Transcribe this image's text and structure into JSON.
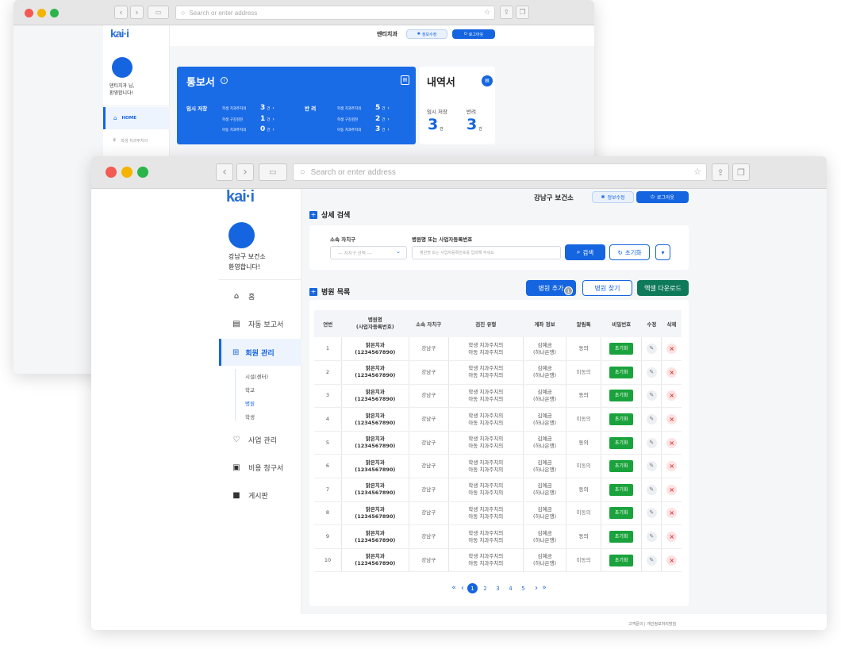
{
  "back_window": {
    "address_placeholder": "Search or enter address",
    "header": {
      "org_name": "덴티치과",
      "edit_info": "정보수정",
      "logout": "로그아웃"
    },
    "logo": "kai·i",
    "logo_sub": "",
    "user": {
      "name_line": "덴티치과 님,",
      "welcome": "환영합니다!"
    },
    "menu": {
      "home": "HOME",
      "school": "학생 치과주치의"
    },
    "report_card": {
      "title": "통보서",
      "temp_save_label": "임시 저장",
      "return_label": "반 려",
      "temp_rows": [
        {
          "label": "학생 치과주치의",
          "count": "3",
          "unit": "건"
        },
        {
          "label": "학생 구강검진",
          "count": "1",
          "unit": "건"
        },
        {
          "label": "아동 치과주치의",
          "count": "0",
          "unit": "건"
        }
      ],
      "return_rows": [
        {
          "label": "학생 치과주치의",
          "count": "5",
          "unit": "건"
        },
        {
          "label": "학생 구강검진",
          "count": "2",
          "unit": "건"
        },
        {
          "label": "아동 치과주치의",
          "count": "3",
          "unit": "건"
        }
      ]
    },
    "history_card": {
      "title": "내역서",
      "temp_label": "임시 저장",
      "return_label": "반려",
      "temp_count": "3",
      "return_count": "3",
      "unit": "건"
    }
  },
  "front_window": {
    "address_placeholder": "Search or enter address",
    "logo": "kai·i",
    "header": {
      "org_name": "강남구 보건소",
      "edit_info": "정보수정",
      "logout": "로그아웃"
    },
    "user": {
      "name": "강남구 보건소",
      "welcome": "환영합니다!"
    },
    "menu": {
      "home": "홈",
      "auto_report": "자동 보고서",
      "member_mgmt": "회원 관리",
      "sub_items": [
        "시설(센터)",
        "학교",
        "병원",
        "학생"
      ],
      "business_mgmt": "사업 관리",
      "billing": "비용 청구서",
      "board": "게시판"
    },
    "search": {
      "section_title": "상세 검색",
      "region_label": "소속 자치구",
      "region_placeholder": "--- 자치구 선택 ---",
      "hospital_label": "병원명 또는 사업자등록번호",
      "hospital_placeholder": "병원명 또는 사업자등록번호를 입력해 주세요",
      "search_button": "검색",
      "reset_button": "초기화"
    },
    "list": {
      "section_title": "병원 목록",
      "add_button": "병원 추가",
      "add_badge": "1",
      "find_button": "병원 찾기",
      "excel_button": "엑셀 다운로드",
      "columns": [
        "연번",
        "병원명\n(사업자등록번호)",
        "소속 자치구",
        "검진 유형",
        "계좌 정보",
        "알림톡",
        "비밀번호",
        "수정",
        "삭제"
      ],
      "rows": [
        {
          "no": "1",
          "name": "맑은치과",
          "biz": "(1234567890)",
          "region": "강남구",
          "type1": "학생 치과주치의",
          "type2": "아동 치과주치의",
          "acct1": "김예금",
          "acct2": "(하나은행)",
          "notify": "동의",
          "pw": "초기화"
        },
        {
          "no": "2",
          "name": "맑은치과",
          "biz": "(1234567890)",
          "region": "강남구",
          "type1": "학생 치과주치의",
          "type2": "아동 치과주치의",
          "acct1": "김예금",
          "acct2": "(하나은행)",
          "notify": "미동의",
          "pw": "초기화"
        },
        {
          "no": "3",
          "name": "맑은치과",
          "biz": "(1234567890)",
          "region": "강남구",
          "type1": "학생 치과주치의",
          "type2": "아동 치과주치의",
          "acct1": "김예금",
          "acct2": "(하나은행)",
          "notify": "동의",
          "pw": "초기화"
        },
        {
          "no": "4",
          "name": "맑은치과",
          "biz": "(1234567890)",
          "region": "강남구",
          "type1": "학생 치과주치의",
          "type2": "아동 치과주치의",
          "acct1": "김예금",
          "acct2": "(하나은행)",
          "notify": "미동의",
          "pw": "초기화"
        },
        {
          "no": "5",
          "name": "맑은치과",
          "biz": "(1234567890)",
          "region": "강남구",
          "type1": "학생 치과주치의",
          "type2": "아동 치과주치의",
          "acct1": "김예금",
          "acct2": "(하나은행)",
          "notify": "동의",
          "pw": "초기화"
        },
        {
          "no": "6",
          "name": "맑은치과",
          "biz": "(1234567890)",
          "region": "강남구",
          "type1": "학생 치과주치의",
          "type2": "아동 치과주치의",
          "acct1": "김예금",
          "acct2": "(하나은행)",
          "notify": "미동의",
          "pw": "초기화"
        },
        {
          "no": "7",
          "name": "맑은치과",
          "biz": "(1234567890)",
          "region": "강남구",
          "type1": "학생 치과주치의",
          "type2": "아동 치과주치의",
          "acct1": "김예금",
          "acct2": "(하나은행)",
          "notify": "동의",
          "pw": "초기화"
        },
        {
          "no": "8",
          "name": "맑은치과",
          "biz": "(1234567890)",
          "region": "강남구",
          "type1": "학생 치과주치의",
          "type2": "아동 치과주치의",
          "acct1": "김예금",
          "acct2": "(하나은행)",
          "notify": "미동의",
          "pw": "초기화"
        },
        {
          "no": "9",
          "name": "맑은치과",
          "biz": "(1234567890)",
          "region": "강남구",
          "type1": "학생 치과주치의",
          "type2": "아동 치과주치의",
          "acct1": "김예금",
          "acct2": "(하나은행)",
          "notify": "동의",
          "pw": "초기화"
        },
        {
          "no": "10",
          "name": "맑은치과",
          "biz": "(1234567890)",
          "region": "강남구",
          "type1": "학생 치과주치의",
          "type2": "아동 치과주치의",
          "acct1": "김예금",
          "acct2": "(하나은행)",
          "notify": "미동의",
          "pw": "초기화"
        }
      ]
    },
    "pagination": {
      "first": "«",
      "prev": "‹",
      "pages": [
        "1",
        "2",
        "3",
        "4",
        "5"
      ],
      "current": "1",
      "next": "›",
      "last": "»"
    },
    "footer": "고객문의 | 개인정보처리방침"
  },
  "colors": {
    "primary": "#1565e0",
    "excel": "#0f7a5a",
    "reset_green": "#1aa33c",
    "delete_red": "#e23b3b"
  }
}
